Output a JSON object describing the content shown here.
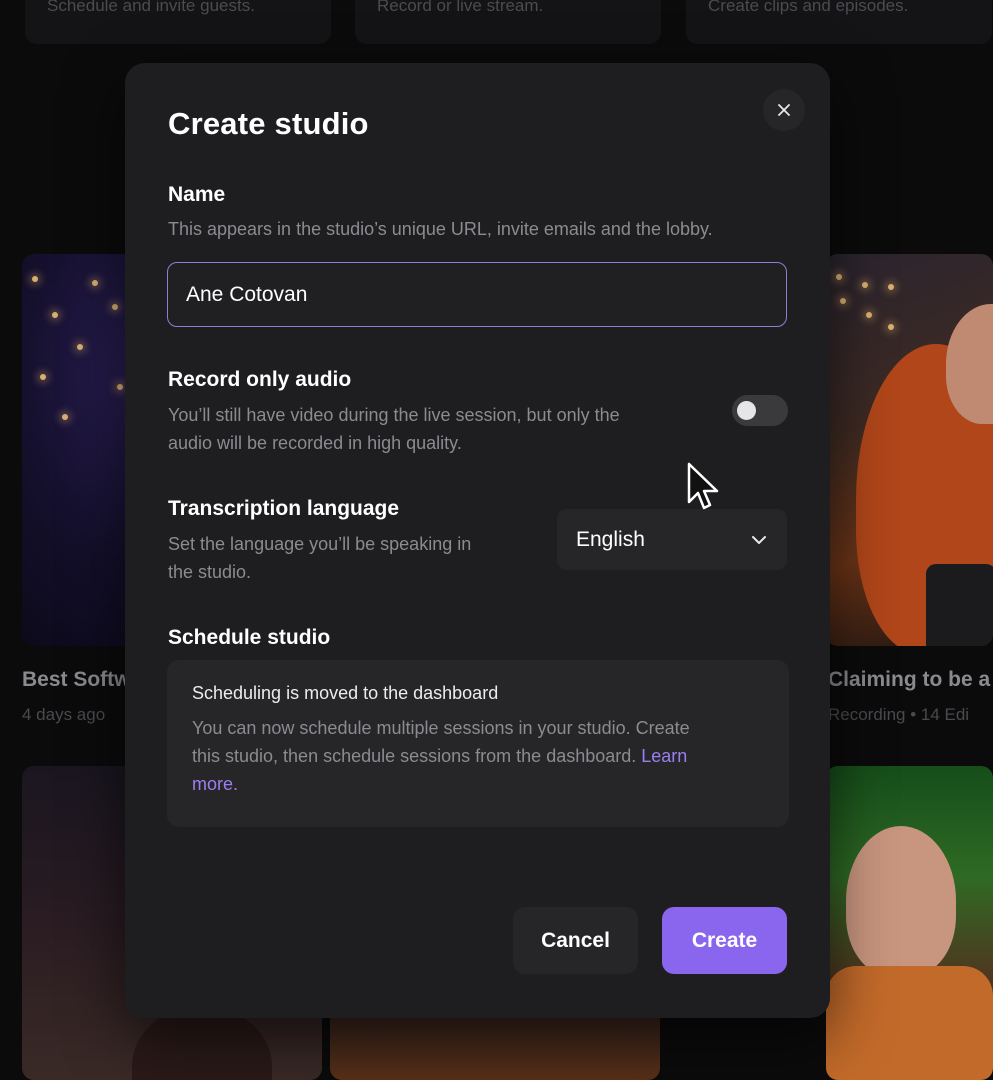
{
  "background": {
    "top_cards": [
      {
        "text": "Schedule and invite guests."
      },
      {
        "text": "Record or live stream."
      },
      {
        "text": "Create clips and episodes."
      }
    ],
    "left_card": {
      "title": "Best Softw",
      "meta": "4 days ago"
    },
    "right_card": {
      "title": "Claiming to be a",
      "meta": "Recording • 14 Edi"
    }
  },
  "modal": {
    "title": "Create studio",
    "close_icon": "close-icon",
    "name": {
      "label": "Name",
      "help": "This appears in the studio’s unique URL, invite emails and the lobby.",
      "value": "Ane Cotovan"
    },
    "record_audio": {
      "label": "Record only audio",
      "help_line1": "You’ll still have video during the live session, but only the",
      "help_line2": "audio will be recorded in high quality.",
      "enabled": false
    },
    "transcription": {
      "label": "Transcription language",
      "help_line1": "Set the language you’ll be speaking in",
      "help_line2": "the studio.",
      "selected": "English",
      "icon": "chevron-down-icon"
    },
    "schedule": {
      "label": "Schedule studio",
      "notice_title": "Scheduling is moved to the dashboard",
      "notice_line1": "You can now schedule multiple sessions in your studio. Create",
      "notice_line2_text": "this studio, then schedule sessions from the dashboard. ",
      "notice_link_part1": "Learn",
      "notice_link_part2": "more."
    },
    "buttons": {
      "cancel": "Cancel",
      "create": "Create"
    }
  },
  "colors": {
    "accent": "#8a66ee",
    "link": "#9b7ff0",
    "input_border": "#8b7fd6",
    "modal_bg": "#1e1e20"
  }
}
